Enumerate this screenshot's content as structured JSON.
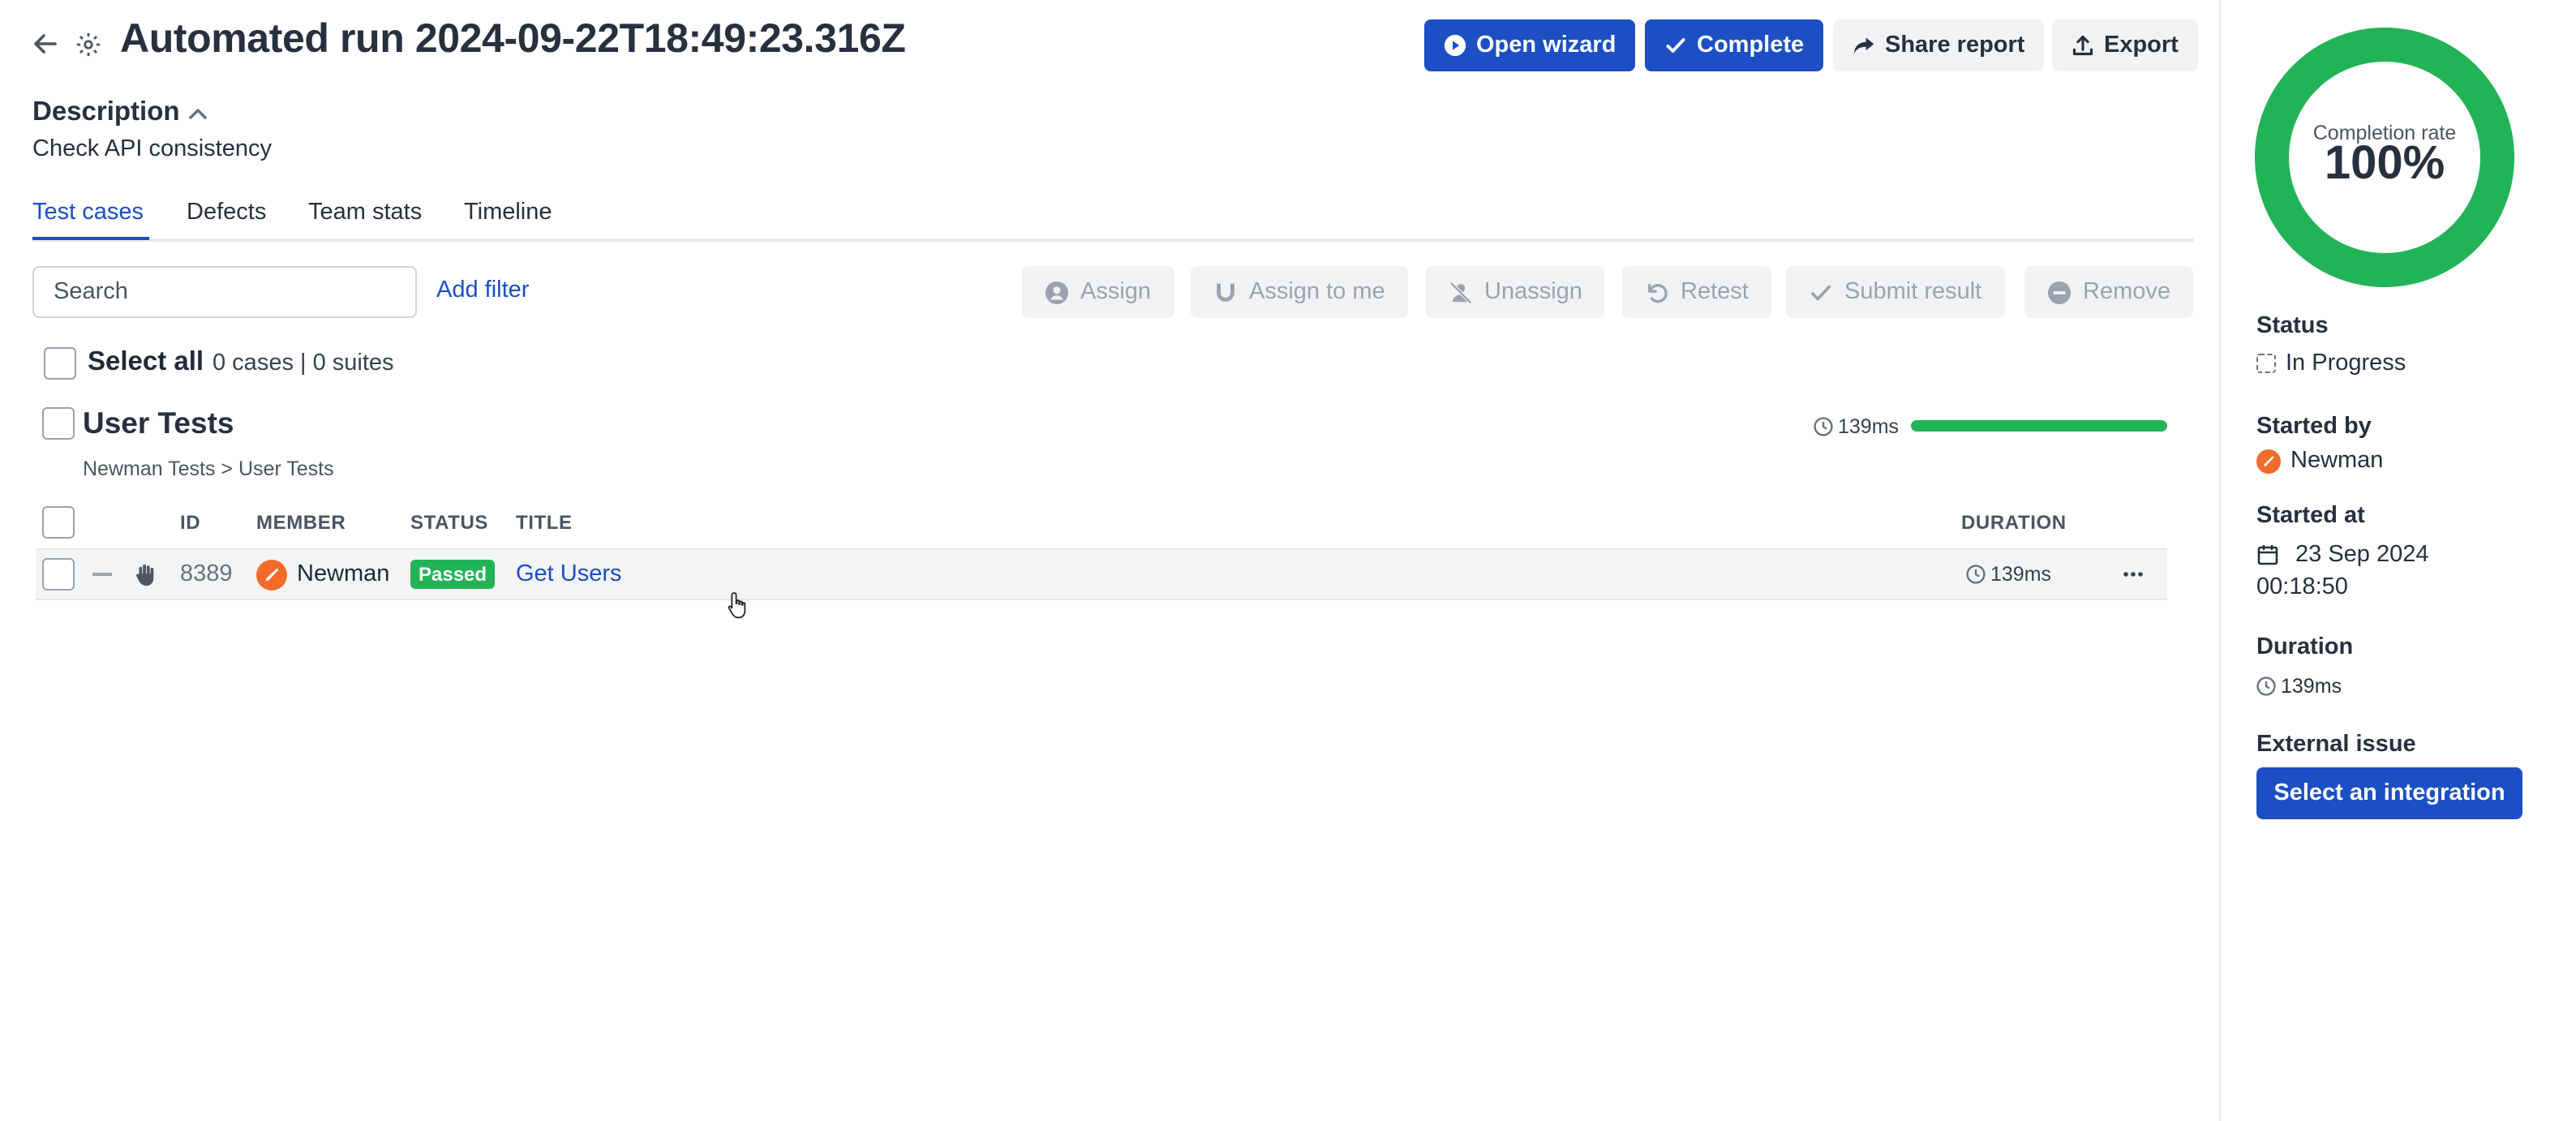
{
  "header": {
    "title": "Automated run 2024-09-22T18:49:23.316Z",
    "open_wizard": "Open wizard",
    "complete": "Complete",
    "share_report": "Share report",
    "export": "Export",
    "primary_color": "#1c4fc3"
  },
  "description": {
    "heading": "Description",
    "text": "Check API consistency"
  },
  "tabs": [
    {
      "label": "Test cases",
      "active": true
    },
    {
      "label": "Defects",
      "active": false
    },
    {
      "label": "Team stats",
      "active": false
    },
    {
      "label": "Timeline",
      "active": false
    }
  ],
  "filters": {
    "search_placeholder": "Search",
    "add_filter": "Add filter"
  },
  "actions": [
    {
      "label": "Assign",
      "icon": "user-circle-icon",
      "disabled": true
    },
    {
      "label": "Assign to me",
      "icon": "magnet-icon",
      "disabled": true
    },
    {
      "label": "Unassign",
      "icon": "user-slash-icon",
      "disabled": true
    },
    {
      "label": "Retest",
      "icon": "undo-icon",
      "disabled": true
    },
    {
      "label": "Submit result",
      "icon": "check-icon",
      "disabled": true
    },
    {
      "label": "Remove",
      "icon": "minus-circle-icon",
      "disabled": true
    }
  ],
  "selection": {
    "label": "Select all",
    "count": "0 cases | 0 suites"
  },
  "suite": {
    "title": "User Tests",
    "duration": "139ms",
    "progress": 1.0,
    "breadcrumb": "Newman Tests > User Tests"
  },
  "table": {
    "columns": {
      "id": "ID",
      "member": "MEMBER",
      "status": "STATUS",
      "title": "TITLE",
      "duration": "DURATION"
    },
    "rows": [
      {
        "id": "8389",
        "member": "Newman",
        "status": "Passed",
        "title": "Get Users",
        "duration": "139ms",
        "status_color": "#22b357"
      }
    ]
  },
  "sidebar": {
    "completion_label": "Completion rate",
    "completion_value": "100%",
    "completion_fraction": 1.0,
    "ring_color": "#22b357",
    "status_heading": "Status",
    "status_value": "In Progress",
    "started_by_heading": "Started by",
    "started_by_value": "Newman",
    "started_at_heading": "Started at",
    "started_at_date": "23 Sep 2024",
    "started_at_time": "00:18:50",
    "duration_heading": "Duration",
    "duration_value": "139ms",
    "external_issue_heading": "External issue",
    "select_integration": "Select an integration"
  }
}
